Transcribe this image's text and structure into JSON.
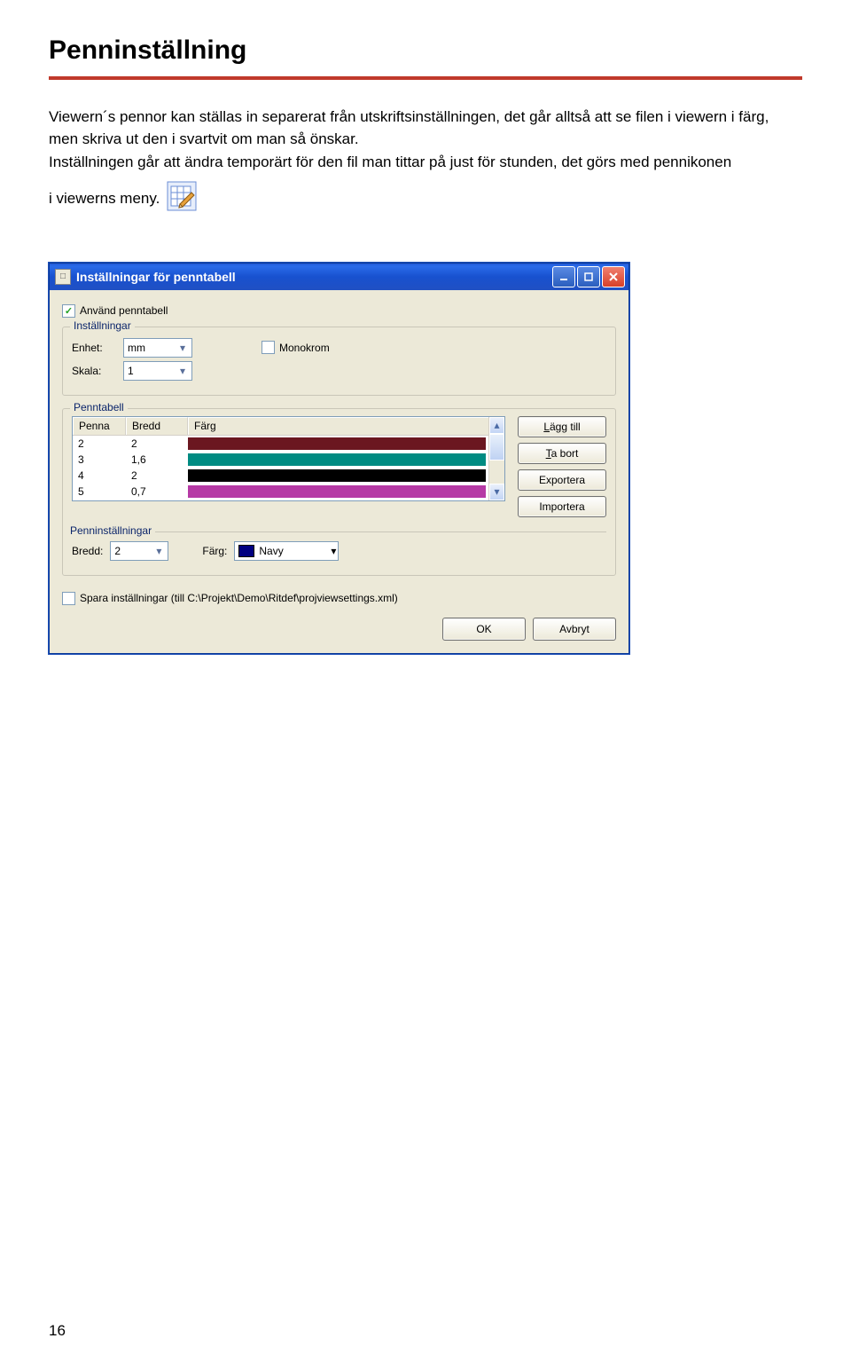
{
  "heading": "Penninställning",
  "para_line1": "Viewern´s pennor kan ställas in separerat från utskriftsinställningen, det går alltså att se filen i viewern i färg, men skriva ut den i svartvit om man så önskar.",
  "para_line2": "Inställningen går att ändra temporärt för den fil man tittar på just för stunden, det görs med pennikonen",
  "para_line3": "i viewerns meny.",
  "page_number": "16",
  "dialog": {
    "title": "Inställningar för penntabell",
    "use_table": "Använd penntabell",
    "group_settings": "Inställningar",
    "label_unit": "Enhet:",
    "value_unit": "mm",
    "label_scale": "Skala:",
    "value_scale": "1",
    "label_mono": "Monokrom",
    "group_table": "Penntabell",
    "col_pen": "Penna",
    "col_width": "Bredd",
    "col_color": "Färg",
    "rows": [
      {
        "pen": "2",
        "width": "2",
        "color": "#6b1720"
      },
      {
        "pen": "3",
        "width": "1,6",
        "color": "#008b82"
      },
      {
        "pen": "4",
        "width": "2",
        "color": "#000000"
      },
      {
        "pen": "5",
        "width": "0,7",
        "color": "#b63aa5"
      }
    ],
    "btn_add": "Lägg till",
    "btn_remove": "Ta bort",
    "btn_export": "Exportera",
    "btn_import": "Importera",
    "group_pen_settings": "Penninställningar",
    "label_widthb": "Bredd:",
    "value_widthb": "2",
    "label_colorb": "Färg:",
    "value_colorb": "Navy",
    "save_label": "Spara inställningar (till C:\\Projekt\\Demo\\Ritdef\\projviewsettings.xml)",
    "btn_ok": "OK",
    "btn_cancel": "Avbryt"
  }
}
